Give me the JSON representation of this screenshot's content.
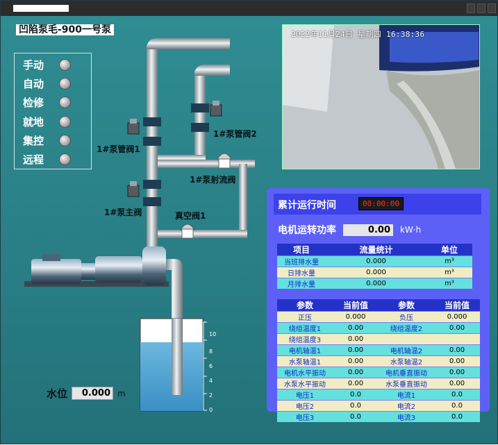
{
  "window": {
    "title": ""
  },
  "station_title": "凹陷泵毛-900一号泵",
  "modes": [
    "手动",
    "自动",
    "检修",
    "就地",
    "集控",
    "远程"
  ],
  "valves": {
    "pump_pipe_valve_1": "1#泵管阀1",
    "pump_pipe_valve_2": "1#泵管阀2",
    "pump_jet_valve": "1#泵射流阀",
    "pump_main_valve": "1#泵主阀",
    "vacuum_valve": "真空阀1"
  },
  "camera": {
    "timestamp": "2022年11月24日  星期四  16:38:36"
  },
  "tank": {
    "scale": [
      "10",
      "8",
      "6",
      "4",
      "2",
      "0"
    ],
    "level_fraction": 0.0
  },
  "water_level": {
    "label": "水位",
    "value": "0.000",
    "unit": "m"
  },
  "runtime": {
    "label": "累计运行时间",
    "value": "00:00:00"
  },
  "power": {
    "label": "电机运转功率",
    "value": "0.00",
    "unit": "kW·h"
  },
  "flow_table": {
    "headers": [
      "项目",
      "流量统计",
      "单位"
    ],
    "rows": [
      [
        "当班排水量",
        "0.000",
        "m³"
      ],
      [
        "日排水量",
        "0.000",
        "m³"
      ],
      [
        "月排水量",
        "0.000",
        "m³"
      ]
    ]
  },
  "param_table": {
    "headers": [
      "参数",
      "当前值",
      "参数",
      "当前值"
    ],
    "rows": [
      [
        "正压",
        "0.000",
        "负压",
        "0.000"
      ],
      [
        "绕组温度1",
        "0.00",
        "绕组温度2",
        "0.00"
      ],
      [
        "绕组温度3",
        "0.00",
        "",
        ""
      ],
      [
        "电机轴温1",
        "0.00",
        "电机轴温2",
        "0.00"
      ],
      [
        "水泵轴温1",
        "0.00",
        "水泵轴温2",
        "0.00"
      ],
      [
        "电机水平振动",
        "0.00",
        "电机垂直振动",
        "0.00"
      ],
      [
        "水泵水平振动",
        "0.00",
        "水泵垂直振动",
        "0.00"
      ],
      [
        "电压1",
        "0.0",
        "电流1",
        "0.0"
      ],
      [
        "电压2",
        "0.0",
        "电流2",
        "0.0"
      ],
      [
        "电压3",
        "0.0",
        "电流3",
        "0.0"
      ]
    ]
  },
  "colors": {
    "background": "#2f8d93",
    "panel": "#5d60f6",
    "table_header": "#2532c8",
    "row_cyan": "#64e0de",
    "row_cream": "#f0edc4"
  }
}
